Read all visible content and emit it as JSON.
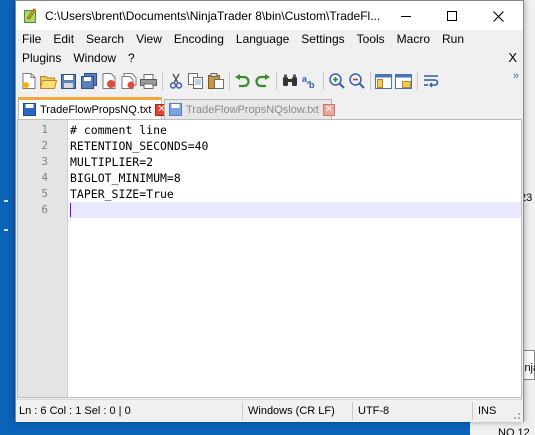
{
  "window": {
    "title": "C:\\Users\\brent\\Documents\\NinjaTrader 8\\bin\\Custom\\TradeFl..."
  },
  "menu": {
    "row1": [
      "File",
      "Edit",
      "Search",
      "View",
      "Encoding",
      "Language",
      "Settings",
      "Tools",
      "Macro",
      "Run"
    ],
    "row2": [
      "Plugins",
      "Window",
      "?"
    ],
    "close_label": "X"
  },
  "toolbar": {
    "icons": [
      "new-file-icon",
      "open-file-icon",
      "save-icon",
      "save-all-icon",
      "close-icon",
      "close-all-icon",
      "print-icon",
      "cut-icon",
      "copy-icon",
      "paste-icon",
      "undo-icon",
      "redo-icon",
      "find-icon",
      "replace-icon",
      "zoom-in-icon",
      "zoom-out-icon",
      "sync-vertical-icon",
      "sync-horizontal-icon",
      "word-wrap-icon"
    ],
    "more_label": "»"
  },
  "tabs": [
    {
      "label": "TradeFlowPropsNQ.txt",
      "active": true
    },
    {
      "label": "TradeFlowPropsNQslow.txt",
      "active": false
    }
  ],
  "editor": {
    "line_numbers": [
      "1",
      "2",
      "3",
      "4",
      "5",
      "6"
    ],
    "lines": [
      "# comment line",
      "RETENTION_SECONDS=40",
      "MULTIPLIER=2",
      "BIGLOT_MINIMUM=8",
      "TAPER_SIZE=True",
      ""
    ],
    "current_line": 6
  },
  "status": {
    "position": "Ln : 6    Col : 1    Sel : 0 | 0",
    "eol": "Windows (CR LF)",
    "encoding": "UTF-8",
    "mode": "INS"
  },
  "background": {
    "fragments": [
      "23",
      "inja",
      "NQ 12"
    ]
  },
  "colors": {
    "tab_accent": "#f3a73d",
    "current_line": "#e8e8ff",
    "caret": "#8000ff",
    "desktop": "#0a63b8"
  }
}
